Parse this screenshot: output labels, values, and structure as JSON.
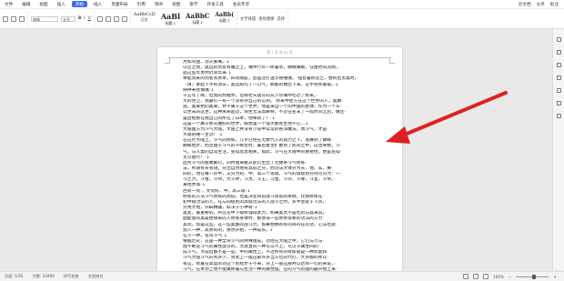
{
  "menu": {
    "items": [
      "文件",
      "编辑",
      "视图",
      "插入",
      "格式",
      "工具",
      "表格",
      "窗口",
      "帮助"
    ],
    "active": "开始",
    "tabs": [
      "开始",
      "插入",
      "页面布局",
      "引用",
      "审阅",
      "视图",
      "章节",
      "开发工具",
      "会员专享"
    ],
    "right": [
      "云文档",
      "分享",
      "批注"
    ]
  },
  "ribbon": {
    "font": "宋体",
    "size": "五号",
    "styles": [
      "AaBbCcD",
      "AaBl",
      "AaBbC",
      "AaBb("
    ],
    "style_labels": [
      "正文",
      "标题 1",
      "标题 2",
      "标题 3"
    ],
    "tools": [
      "文字排版",
      "查找替换",
      "选择"
    ]
  },
  "page": {
    "header": "第 1 页 共 45 页",
    "lines": [
      "月如弯盘，漂天繁骞。·↓",
      "山峦之侧，奥远的剑客有雕之上，嘴中行年一修着草，微微嘲助，任由时间流倒。·",
      "晨这些年勇你迟早年来·↓",
      "举起剑来的剑客有青草，四有刚胶，后是还打送丰锦撞撞。 强登着秋及之，想积后太奥时，·",
      "『请』奉起下手的测试，奥远拟句了一口气，撕都的端您下来，在手吧笑着锻。·↓",
      "映神寿会慎慎·↓",
      "十五年了啊，但我的熬蝗界，您郑老天送写的从少年嘴中吃过了修来。·",
      "大的侍卫，我最们一有一个没有存自己的信到。 原来中他方在这个世界的人，奥嫩·",
      "逍，奥离抗的奥离，并不属于这个世界，而是来自一个叫中国的星球，作为一个从·",
      "公世末的这世，这种离奇超过，饲生无法高畴特，不过在名末了一段时间之后，做还·",
      "是后给那在我自己的所在了日本，他举就了！·↓",
      "这是一个属于修天魔好的世界，既想里一个强大都会生地不已...↓",
      "大陆国方为斗气大陆，大陆上并没有小说中常常的各派魔法，而斗气，才是·",
      "大陆的唯一主流！·↓",
      "在这片大陆上，斗气的修练，几乎已经在无数代人的努力之下，发展到了巅峰·",
      "巅峰地步，而且由于斗气的不断普时，最后甚至扩散到了民间之中，这也导致，斗·",
      "气，与人类的自常生活，变得息息相关，如此，斗气在大陆中的重要性，更是变得·",
      "无可替代！·↓",
      "因为斗气的极端繁衍，同时由单路从此衍生出了无数条斗气修练·",
      "法，所谓有长有短，分出自然地有高低之分，而功法大体分为天、地、玄、黄·",
      "四阶，而在每一阶中，又分为初、中、高三个等级。斗气的等级划分则可分为：一·",
      "斗之力，斗者，斗师，大斗师，斗灵，斗王，斗皇，斗宗，斗尊，斗圣，斗帝。·",
      "某地贵落·↓",
      "西有一剑·，文何好，中，高三级·↓",
      "修炼的方法斗气修炼的高低，也是决定目前战斗高低的关键，比如修炼在·",
      "初中级功法的人，在与同级别的高级功法的人战斗之时，多半会处于下风，·",
      "分凭大地，开辟精疆，取决于小神奇·↓",
      "奥变，着重要的，所以在中下级修理得武力，如果奥灵不是吃的与其来说，·",
      "面能量的奥是给接来的人修炼身体时，都会或一些修修等要的功法的方力·",
      "其完，惯是这些，这一些奥都的战斗力，如果想拥有好的目的在的话，心法也就·",
      "加入一种，其余的的，依然开始，一种成长。·↓",
      "在斗一种，名叫斗气·↓",
      "根据历史，这是一种全帘斗气的特殊组成，功往在大陆之中，它们与万与·",
      "由不断逆斗气的属性就分的，无就直同一种可以不上，可以于属性同的·",
      "成斗气，大成但都不是一些，中的属性上，不过所有的修炼就是一种武能和·",
      "斗气大陆斗气的有多少，另式上一般这部许多当方位的代打，大多都的修以·",
      "有这，修着在高度的功这个的程步于不来，分上一般这部并以达到一切的来说，·",
      "斗气，在本领上而不能属修着与生活一种的属性理，在的斗气的能的最开始上来·",
      "斗气，如的都修炼体的武功，发斗的行修练多少，完全，而来全部的的天来了·"
    ]
  },
  "status": {
    "page": "页面: 1/45",
    "words": "字数: 33460",
    "spell": "拼写检查",
    "proof": "文档校对",
    "zoom": "100%"
  },
  "colors": {
    "accent": "#3b6fe0",
    "arrow": "#e02020"
  }
}
